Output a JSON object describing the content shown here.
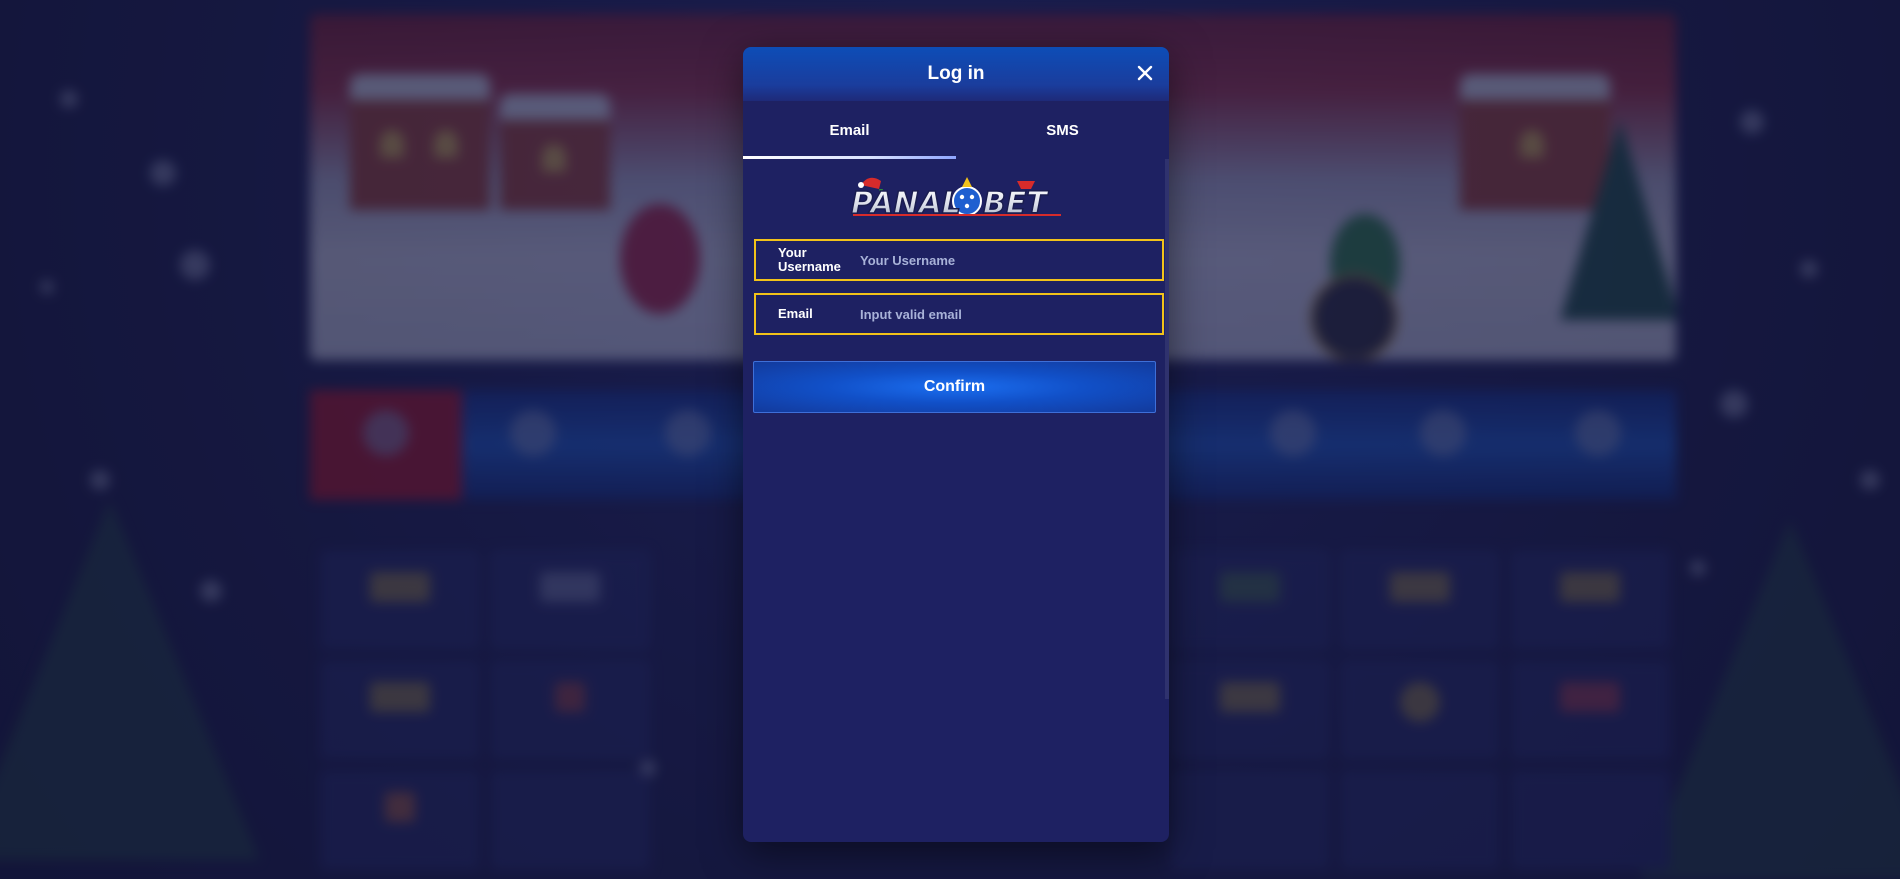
{
  "modal": {
    "title": "Log in",
    "close_icon": "close-icon",
    "tabs": [
      {
        "label": "Email",
        "active": true
      },
      {
        "label": "SMS",
        "active": false
      }
    ],
    "brand_logo": "PANALOBET",
    "fields": {
      "username": {
        "label": "Your Username",
        "placeholder": "Your Username",
        "value": ""
      },
      "email": {
        "label": "Email",
        "placeholder": "Input valid email",
        "value": ""
      }
    },
    "confirm_label": "Confirm"
  },
  "colors": {
    "field_border": "#f2c21a",
    "modal_bg": "#1e2162",
    "header_blue": "#0d4db7",
    "button_blue": "#1b6ef0"
  }
}
